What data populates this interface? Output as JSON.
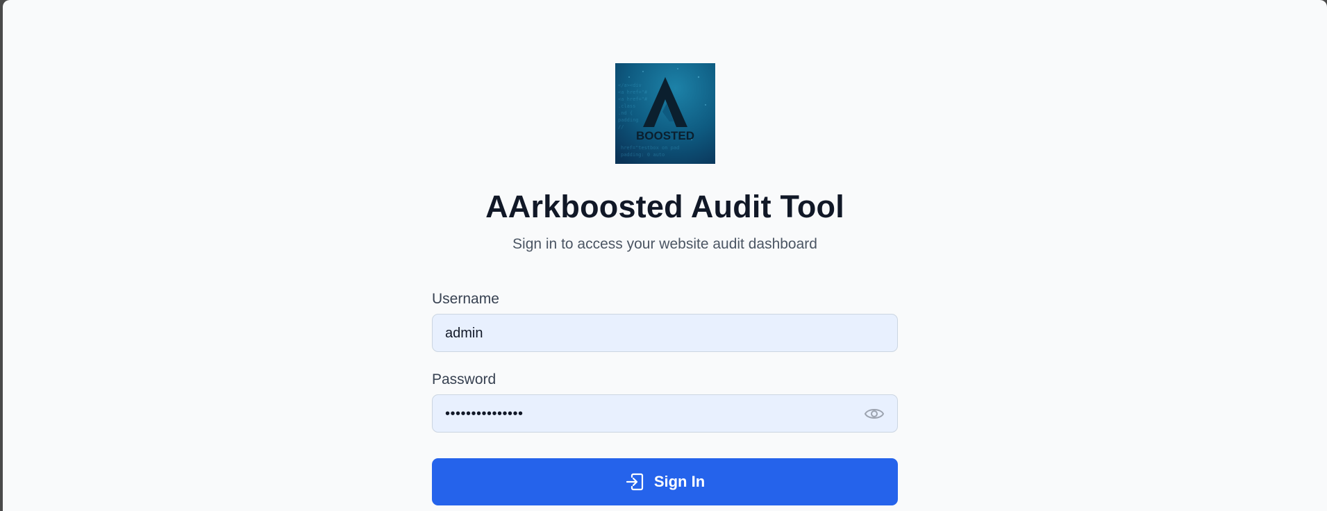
{
  "logo": {
    "text": "BOOSTED",
    "icon": "aarkboosted-logo"
  },
  "header": {
    "title": "AArkboosted Audit Tool",
    "subtitle": "Sign in to access your website audit dashboard"
  },
  "form": {
    "username_label": "Username",
    "username_value": "admin",
    "password_label": "Password",
    "password_value": "•••••••••••••••",
    "password_toggle_icon": "eye-icon",
    "submit_label": "Sign In",
    "submit_icon": "sign-in-icon"
  },
  "colors": {
    "background": "#f9fafb",
    "primary": "#2563eb",
    "input_background": "#e8f0fe",
    "title": "#111827"
  }
}
